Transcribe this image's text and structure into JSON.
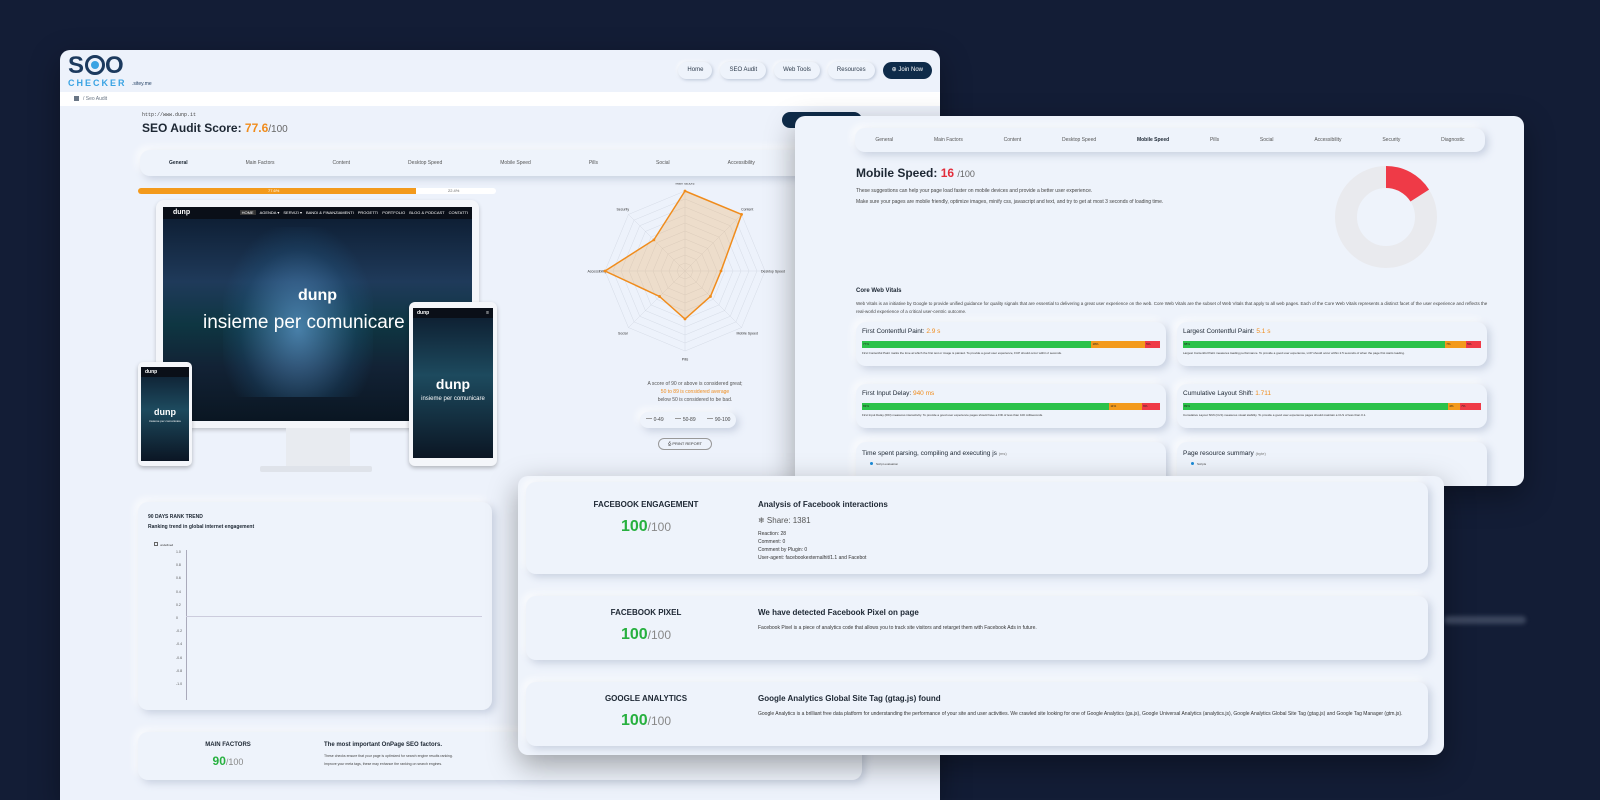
{
  "main": {
    "logo_line1": "SEO",
    "logo_line2": "CHECKER",
    "logo_line3": ".sitey.me",
    "nav": [
      "Home",
      "SEO Audit",
      "Web Tools",
      "Resources"
    ],
    "join": "Join Now",
    "breadcrumb": "/ Seo Audit",
    "site_url": "http://www.dunp.it",
    "score_label": "SEO Audit Score:",
    "score_value": "77.6",
    "score_max": "/100",
    "tabs": [
      "General",
      "Main Factors",
      "Content",
      "Desktop Speed",
      "Mobile Speed",
      "Pills",
      "Social",
      "Accessibility",
      "Security"
    ],
    "active_tab": "General",
    "progress_pct": 77.6,
    "progress_label": "77.6%",
    "progress_rest_label": "22.4%",
    "site_brand": "dunp",
    "site_nav_links": [
      "HOME",
      "AGENDA ▾",
      "SERVIZI ▾",
      "BANDI & FINANZIAMENTI",
      "PROGETTI",
      "PORTFOLIO",
      "BLOG & PODCAST",
      "CONTATTI"
    ],
    "site_slogan": "insieme per comunicare",
    "radar_labels": [
      "Main factors",
      "Content",
      "Desktop Speed",
      "Mobile Speed",
      "Pills",
      "Social",
      "Accessibility",
      "Security"
    ],
    "legend_line1": "A score of 90 or above is considered great;",
    "legend_line2": "50 to 89 is considered average",
    "legend_line3": "below 50 is considered to be bad.",
    "ranges": [
      "0-49",
      "50-89",
      "90-100"
    ],
    "print_label": "PRINT REPORT",
    "trend_title": "90 DAYS RANK TREND",
    "trend_subtitle": "Ranking trend in global internet engagement",
    "trend_legend": "undefined",
    "trend_ticks": [
      "1.0",
      "0.8",
      "0.6",
      "0.4",
      "0.2",
      "0",
      "-0.2",
      "-0.4",
      "-0.6",
      "-0.8",
      "-1.0"
    ],
    "main_factors_label": "MAIN FACTORS",
    "main_factors_score": "90",
    "main_factors_max": "/100",
    "main_factors_heading": "The most important OnPage SEO factors.",
    "main_factors_desc1": "These checks ensure that your page is optimized for search engine results ranking.",
    "main_factors_desc2": "Improve your meta tags, these may enhance the ranking on search engines."
  },
  "speed": {
    "tabs": [
      "General",
      "Main Factors",
      "Content",
      "Desktop Speed",
      "Mobile Speed",
      "Pills",
      "Social",
      "Accessibility",
      "Security",
      "Diagnostic"
    ],
    "active_tab": "Mobile Speed",
    "title": "Mobile Speed:",
    "score": "16",
    "max": "/100",
    "desc1": "These suggestions can help your page load faster on mobile devices and provide a better user experience.",
    "desc2": "Make sure your pages are mobile friendly, optimize images, minify css, javascript and text, and try to get at most 3 seconds of loading time.",
    "donut_fraction": 0.16,
    "cwv_title": "Core Web Vitals",
    "cwv_desc": "Web Vitals is an initiative by Google to provide unified guidance for quality signals that are essential to delivering a great user experience on the web. Core Web Vitals are the subset of Web Vitals that apply to all web pages. Each of the Core Web Vitals represents a distinct facet of the user experience and reflects the real-world experience of a critical user-centric outcome.",
    "metrics": [
      {
        "label": "First Contentful Paint:",
        "value": "2.9 s",
        "green": 77,
        "orange": 18,
        "red": 5,
        "g_lbl": "77%",
        "o_lbl": "18%",
        "r_lbl": "5%",
        "note": "First Contentful Paint marks the time at which the first text or image is painted. To provide a good user experience, FCP should occur within 2 seconds."
      },
      {
        "label": "Largest Contentful Paint:",
        "value": "5.1 s",
        "green": 88,
        "orange": 7,
        "red": 5,
        "g_lbl": "88%",
        "o_lbl": "7%",
        "r_lbl": "5%",
        "note": "Largest Contentful Paint measures loading performance. To provide a good user experience, LCP should occur within 2.5 seconds of when the page first starts loading."
      },
      {
        "label": "First Input Delay:",
        "value": "940 ms",
        "green": 83,
        "orange": 11,
        "red": 6,
        "g_lbl": "83%",
        "o_lbl": "11%",
        "r_lbl": "6%",
        "note": "First Input Delay (FID) measures interactivity. To provide a good user experience pages should have a FID of less than 100 milliseconds."
      },
      {
        "label": "Cumulative Layout Shift:",
        "value": "1.711",
        "green": 89,
        "orange": 4,
        "red": 7,
        "g_lbl": "89%",
        "o_lbl": "4%",
        "r_lbl": "7%",
        "note": "Cumulative Layout Shift (CLS) measures visual stability. To provide a good user experience pages should maintain a CLS of less than 0.1."
      }
    ],
    "parse_title": "Time spent parsing, compiling and executing js",
    "parse_unit": "(ms)",
    "parse_legend": "Script evaluation",
    "resource_title": "Page resource summary",
    "resource_unit": "(byte)",
    "resource_legend": "Scripts"
  },
  "social": {
    "cards": [
      {
        "label": "FACEBOOK ENGAGEMENT",
        "score": "100",
        "max": "/100",
        "heading": "Analysis of Facebook interactions",
        "share": "❄ Share: 1381",
        "lines": [
          "Reaction: 28",
          "Comment: 0",
          "Comment by Plugin: 0",
          "User-agent: facebookexternalhit/1.1 and Facebot"
        ]
      },
      {
        "label": "FACEBOOK PIXEL",
        "score": "100",
        "max": "/100",
        "heading": "We have detected Facebook Pixel on page",
        "lines": [
          "Facebook Pixel is a piece of analytics code that allows you to track site visitors and retarget them with Facebook Ads in future."
        ]
      },
      {
        "label": "GOOGLE ANALYTICS",
        "score": "100",
        "max": "/100",
        "heading": "Google Analytics Global Site Tag (gtag.js) found",
        "lines": [
          "Google Analytics is a brilliant free data platform for understanding the performance of your site and user activities. We crawled site looking for one of Google Analytics (ga.js), Google Universal Analytics (analytics.js), Google Analytics Global Site Tag (gtag.js) and Google Tag Manager (gtm.js)."
        ]
      }
    ]
  },
  "colors": {
    "accent_orange": "#f08c1c",
    "good_green": "#27b03f",
    "bad_red": "#e22d3b",
    "navy": "#0f2c4a"
  }
}
